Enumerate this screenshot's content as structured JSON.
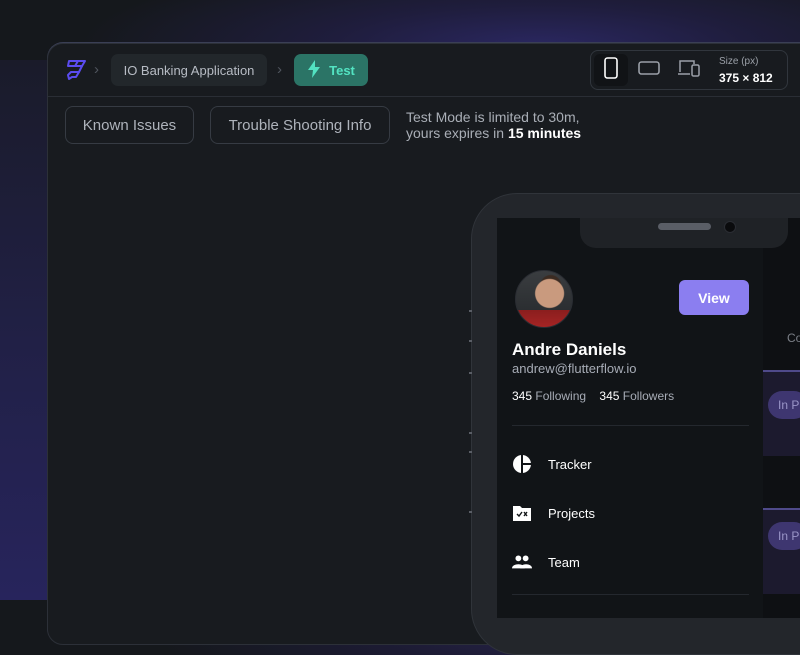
{
  "header": {
    "breadcrumb_project": "IO Banking Application",
    "mode_label": "Test",
    "size_label": "Size (px)",
    "size_value": "375 × 812",
    "devices": [
      "phone-portrait-icon",
      "tablet-landscape-icon",
      "desktop-and-phone-icon"
    ],
    "active_device": "phone-portrait-icon"
  },
  "toolbar": {
    "known_issues_label": "Known Issues",
    "troubleshooting_label": "Trouble Shooting Info",
    "notice_line1": "Test Mode is limited to 30m,",
    "notice_line2_prefix": "yours expires in ",
    "notice_line2_bold": "15 minutes"
  },
  "app": {
    "profile": {
      "name": "Andre Daniels",
      "email": "andrew@flutterflow.io",
      "following_count": "345",
      "following_label": "Following",
      "followers_count": "345",
      "followers_label": "Followers",
      "view_button_label": "View"
    },
    "menu": [
      {
        "icon": "pie-chart-icon",
        "label": "Tracker"
      },
      {
        "icon": "folder-check-icon",
        "label": "Projects"
      },
      {
        "icon": "team-icon",
        "label": "Team"
      }
    ],
    "background_pane": {
      "header_partial": "Co",
      "chips": [
        "In Pr",
        "In Pr"
      ]
    }
  },
  "colors": {
    "accent_purple": "#8b7ef0",
    "test_green_bg": "#2b7466",
    "test_green_fg": "#53e3c2",
    "logo_purple": "#5b4cf0"
  }
}
